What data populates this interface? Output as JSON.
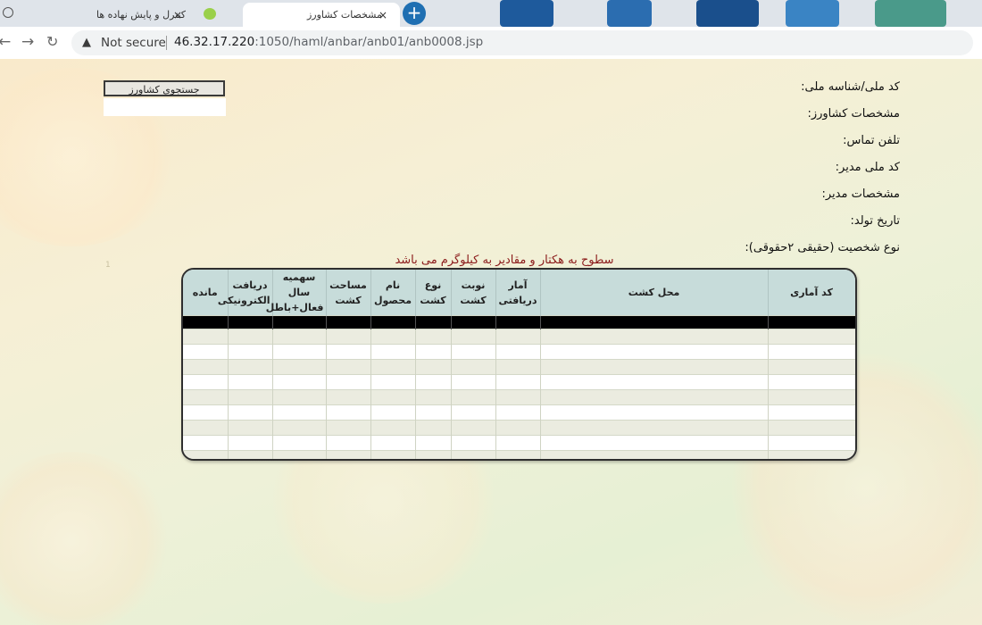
{
  "browser": {
    "tabs": [
      {
        "title": "کنترل و پایش نهاده ها",
        "active": false
      },
      {
        "title": "",
        "active": false,
        "icon": "chat-bubble-icon"
      },
      {
        "title": "مشخصات کشاورز",
        "active": true
      }
    ],
    "close_glyph": "×",
    "new_tab_glyph": "+",
    "security_label": "Not secure",
    "url_host": "46.32.17.220",
    "url_rest": ":1050/haml/anbar/anb01/anb0008.jsp"
  },
  "page": {
    "search_button": "جستجوی کشاورز",
    "search_value": "",
    "info_labels": [
      "کد ملی/شناسه ملی:",
      "مشخصات کشاورز:",
      "تلفن تماس:",
      "کد ملی مدیر:",
      "مشخصات مدیر:",
      "تاریخ تولد:",
      "نوع شخصیت (حقیقی ۲حقوقی):"
    ],
    "notice": "سطوح به هکتار و مقادیر به کیلوگرم می باشد",
    "tiny_mark": "1"
  },
  "table": {
    "columns": [
      "مانده",
      "دریافت\nالکترونیکی",
      "سهمیه سال\nفعال+باطل",
      "مساحت\nکشت",
      "نام\nمحصول",
      "نوع\nکشت",
      "نوبت\nکشت",
      "آمار\nدریافتی",
      "محل کشت",
      "کد آماری"
    ],
    "rows": [
      [
        "",
        "",
        "",
        "",
        "",
        "",
        "",
        "",
        "",
        ""
      ],
      [
        "",
        "",
        "",
        "",
        "",
        "",
        "",
        "",
        "",
        ""
      ],
      [
        "",
        "",
        "",
        "",
        "",
        "",
        "",
        "",
        "",
        ""
      ],
      [
        "",
        "",
        "",
        "",
        "",
        "",
        "",
        "",
        "",
        ""
      ],
      [
        "",
        "",
        "",
        "",
        "",
        "",
        "",
        "",
        "",
        ""
      ],
      [
        "",
        "",
        "",
        "",
        "",
        "",
        "",
        "",
        "",
        ""
      ],
      [
        "",
        "",
        "",
        "",
        "",
        "",
        "",
        "",
        "",
        ""
      ],
      [
        "",
        "",
        "",
        "",
        "",
        "",
        "",
        "",
        "",
        ""
      ],
      [
        "",
        "",
        "",
        "",
        "",
        "",
        "",
        "",
        "",
        ""
      ],
      [
        "",
        "",
        "",
        "",
        "",
        "",
        "",
        "",
        "",
        ""
      ]
    ]
  },
  "colors": {
    "header_bg": "#c7dcda",
    "notice": "#8b1a1a",
    "accent_blue": "#1f6fb2"
  }
}
